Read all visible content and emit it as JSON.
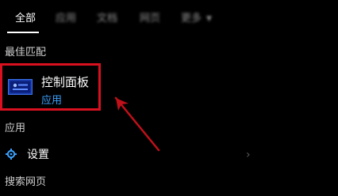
{
  "tabs": [
    {
      "label": "全部"
    },
    {
      "label": "应用"
    },
    {
      "label": "文档"
    },
    {
      "label": "网页"
    },
    {
      "label": "更多"
    }
  ],
  "sections": {
    "best_match": "最佳匹配",
    "apps": "应用",
    "web": "搜索网页"
  },
  "best_match": {
    "name": "控制面板",
    "type": "应用"
  },
  "apps": [
    {
      "label": "设置",
      "icon": "gear-icon"
    }
  ],
  "colors": {
    "background": "#000000",
    "highlight_border": "#d8101f",
    "accent": "#3ba2ff",
    "annotation_arrow": "#c0101a"
  }
}
